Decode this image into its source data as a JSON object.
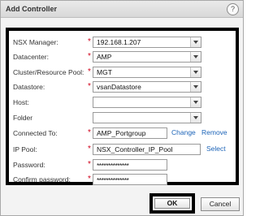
{
  "window": {
    "title": "Add Controller",
    "help_label": "?"
  },
  "form": {
    "nsx_manager": {
      "label": "NSX Manager:",
      "value": "192.168.1.207"
    },
    "datacenter": {
      "label": "Datacenter:",
      "value": "AMP"
    },
    "cluster": {
      "label": "Cluster/Resource Pool:",
      "value": "MGT"
    },
    "datastore": {
      "label": "Datastore:",
      "value": "vsanDatastore"
    },
    "host": {
      "label": "Host:",
      "value": ""
    },
    "folder": {
      "label": "Folder",
      "value": ""
    },
    "connected_to": {
      "label": "Connected To:",
      "value": "AMP_Portgroup",
      "change_label": "Change",
      "remove_label": "Remove"
    },
    "ip_pool": {
      "label": "IP Pool:",
      "value": "NSX_Controller_IP_Pool",
      "select_label": "Select"
    },
    "password": {
      "label": "Password:",
      "value": "**************"
    },
    "confirm_password": {
      "label": "Confirm password:",
      "value": "**************"
    },
    "required_marker": "*"
  },
  "buttons": {
    "ok": "OK",
    "cancel": "Cancel"
  },
  "colors": {
    "required": "#d0021b",
    "link": "#1c64b8"
  }
}
